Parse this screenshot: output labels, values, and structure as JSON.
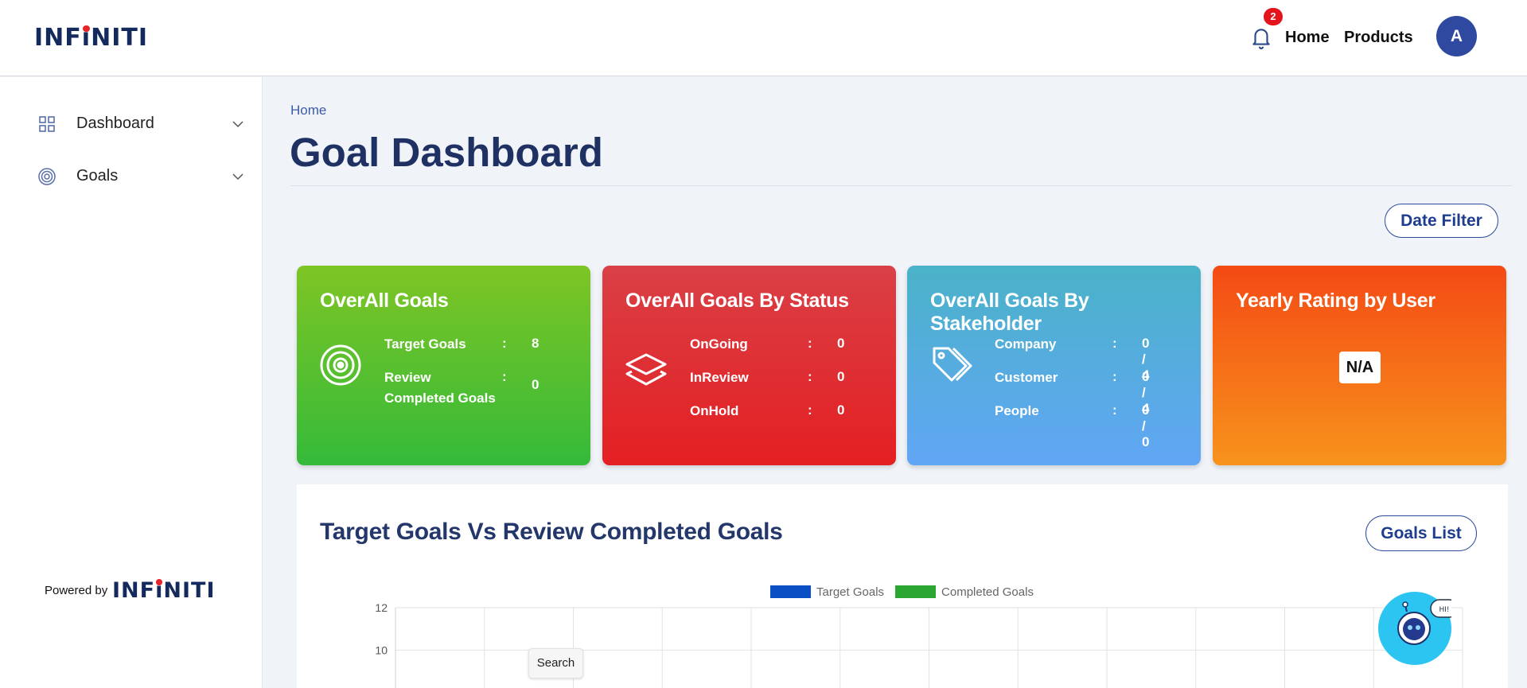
{
  "header": {
    "logo": "INFINITI",
    "notification_count": "2",
    "nav": [
      "Home",
      "Products"
    ],
    "avatar_initial": "A"
  },
  "sidebar": {
    "items": [
      {
        "label": "Dashboard",
        "icon": "grid-icon"
      },
      {
        "label": "Goals",
        "icon": "target-icon"
      }
    ],
    "powered_by": "Powered by",
    "powered_logo": "INFINITI"
  },
  "main": {
    "breadcrumb": "Home",
    "title": "Goal Dashboard",
    "date_filter_label": "Date Filter"
  },
  "cards": [
    {
      "title": "OverAll Goals",
      "icon": "target-icon",
      "rows": [
        {
          "label": "Target Goals",
          "value": "8"
        },
        {
          "label": "Review Completed Goals",
          "value": "0"
        }
      ]
    },
    {
      "title": "OverAll Goals By Status",
      "icon": "layers-icon",
      "rows": [
        {
          "label": "OnGoing",
          "value": "0"
        },
        {
          "label": "InReview",
          "value": "0"
        },
        {
          "label": "OnHold",
          "value": "0"
        }
      ]
    },
    {
      "title": "OverAll Goals By Stakeholder",
      "icon": "tags-icon",
      "rows": [
        {
          "label": "Company",
          "value": "0 / 4"
        },
        {
          "label": "Customer",
          "value": "0 / 4"
        },
        {
          "label": "People",
          "value": "0 / 0"
        }
      ]
    },
    {
      "title": "Yearly Rating by User",
      "value": "N/A"
    }
  ],
  "separator": ":",
  "chart_panel": {
    "title": "Target Goals Vs Review Completed Goals",
    "goals_list_label": "Goals List"
  },
  "chart_data": {
    "type": "bar",
    "title": "",
    "series": [
      {
        "name": "Target Goals",
        "color": "#0b4fc4",
        "values": []
      },
      {
        "name": "Completed Goals",
        "color": "#2aa52f",
        "values": []
      }
    ],
    "y_ticks": [
      "12",
      "10"
    ],
    "grid": true,
    "legend": "top-center"
  },
  "tooltip": "Search",
  "chatbot": {
    "bubble_text": "HI!"
  },
  "colors": {
    "brand": "#142a5c",
    "accent_red": "#e8242b",
    "card_green": "#35ba3a",
    "card_red": "#e41f22",
    "card_blue": "#61a6f5",
    "card_orange": "#f7931c"
  }
}
